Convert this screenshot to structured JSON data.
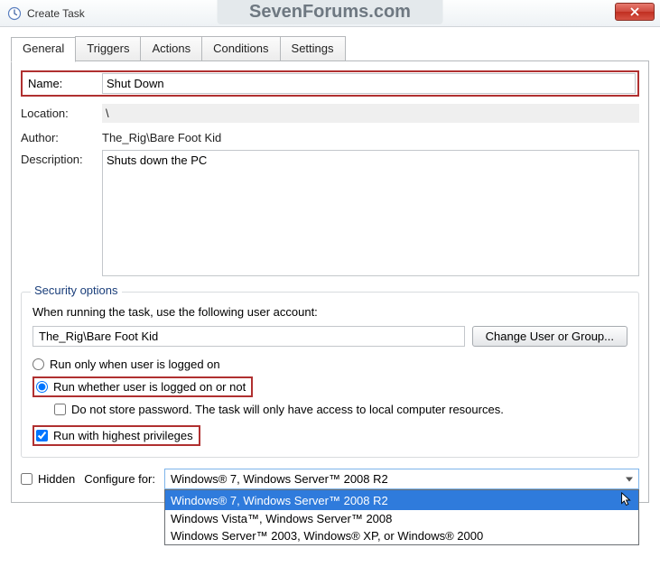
{
  "window": {
    "title": "Create Task",
    "watermark": "SevenForums.com"
  },
  "tabs": {
    "general": "General",
    "triggers": "Triggers",
    "actions": "Actions",
    "conditions": "Conditions",
    "settings": "Settings"
  },
  "labels": {
    "name": "Name:",
    "location": "Location:",
    "author": "Author:",
    "description": "Description:",
    "hidden": "Hidden",
    "configure_for": "Configure for:"
  },
  "values": {
    "name": "Shut Down",
    "location": "\\",
    "author": "The_Rig\\Bare Foot Kid",
    "description": "Shuts down the PC"
  },
  "security": {
    "title": "Security options",
    "running_text": "When running the task, use the following user account:",
    "user_account": "The_Rig\\Bare Foot Kid",
    "change_btn": "Change User or Group...",
    "radio_logged_on": "Run only when user is logged on",
    "radio_whether": "Run whether user is logged on or not",
    "no_store_pw": "Do not store password.  The task will only have access to local computer resources.",
    "highest_priv": "Run with highest privileges"
  },
  "configure": {
    "selected": "Windows® 7, Windows Server™ 2008 R2",
    "options": [
      "Windows® 7, Windows Server™ 2008 R2",
      "Windows Vista™, Windows Server™ 2008",
      "Windows Server™ 2003, Windows® XP, or Windows® 2000"
    ]
  }
}
